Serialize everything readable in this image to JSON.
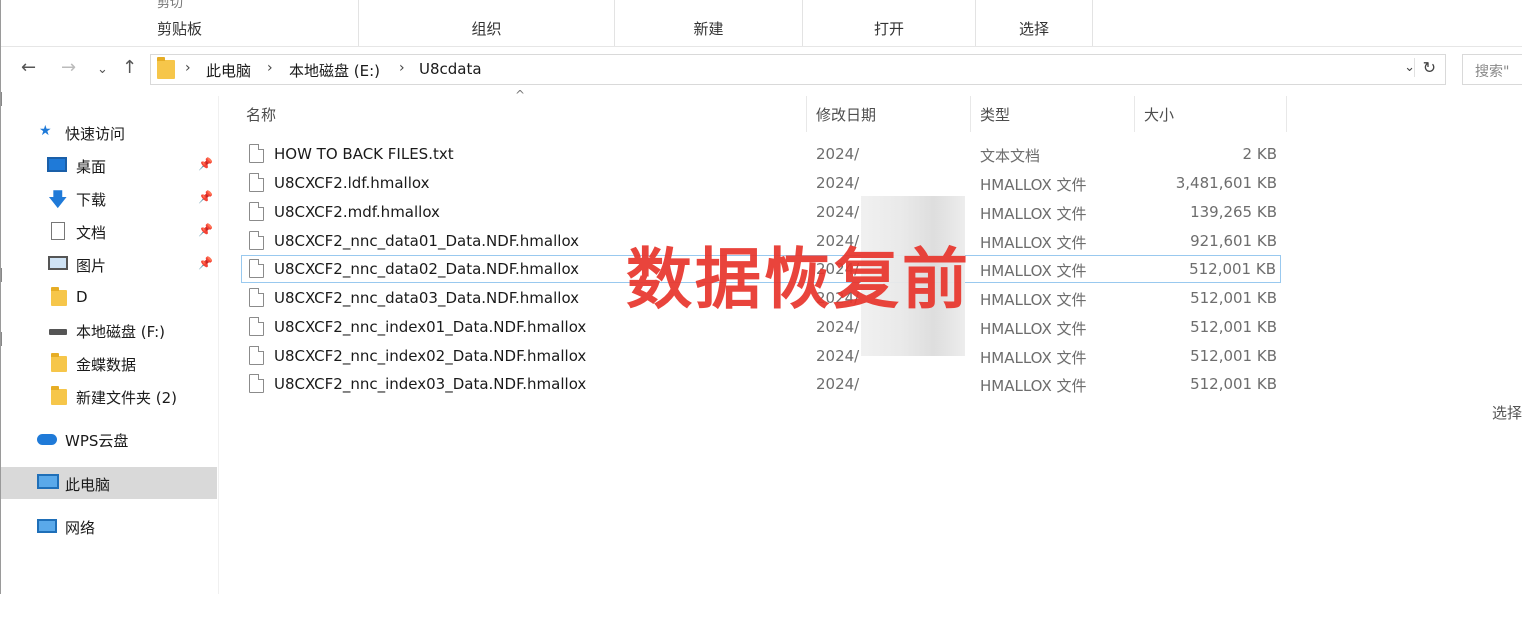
{
  "ribbon": {
    "stub_label": "剪切",
    "groups": [
      "剪贴板",
      "组织",
      "新建",
      "打开",
      "选择"
    ]
  },
  "nav": {
    "back": "←",
    "forward": "→",
    "recent": "⌄",
    "up": "↑"
  },
  "address": {
    "crumbs": [
      "此电脑",
      "本地磁盘 (E:)",
      "U8cdata"
    ],
    "separator": "›",
    "dropdown": "⌄",
    "refresh": "↻"
  },
  "search": {
    "placeholder": "搜索\""
  },
  "sidebar": {
    "items": [
      {
        "label": "快速访问"
      },
      {
        "label": "桌面"
      },
      {
        "label": "下载"
      },
      {
        "label": "文档"
      },
      {
        "label": "图片"
      },
      {
        "label": "D"
      },
      {
        "label": "本地磁盘 (F:)"
      },
      {
        "label": "金蝶数据"
      },
      {
        "label": "新建文件夹 (2)"
      },
      {
        "label": "WPS云盘"
      },
      {
        "label": "此电脑"
      },
      {
        "label": "网络"
      }
    ],
    "pin_glyph": "📌"
  },
  "columns": [
    "名称",
    "修改日期",
    "类型",
    "大小"
  ],
  "sort_caret": "^",
  "files": [
    {
      "name": "HOW TO BACK FILES.txt",
      "date": "2024/",
      "type": "文本文档",
      "size": "2 KB"
    },
    {
      "name": "U8CXCF2.ldf.hmallox",
      "date": "2024/",
      "type": "HMALLOX 文件",
      "size": "3,481,601 KB"
    },
    {
      "name": "U8CXCF2.mdf.hmallox",
      "date": "2024/",
      "type": "HMALLOX 文件",
      "size": "139,265 KB"
    },
    {
      "name": "U8CXCF2_nnc_data01_Data.NDF.hmallox",
      "date": "2024/",
      "type": "HMALLOX 文件",
      "size": "921,601 KB"
    },
    {
      "name": "U8CXCF2_nnc_data02_Data.NDF.hmallox",
      "date": "2024/",
      "type": "HMALLOX 文件",
      "size": "512,001 KB"
    },
    {
      "name": "U8CXCF2_nnc_data03_Data.NDF.hmallox",
      "date": "2024/",
      "type": "HMALLOX 文件",
      "size": "512,001 KB"
    },
    {
      "name": "U8CXCF2_nnc_index01_Data.NDF.hmallox",
      "date": "2024/",
      "type": "HMALLOX 文件",
      "size": "512,001 KB"
    },
    {
      "name": "U8CXCF2_nnc_index02_Data.NDF.hmallox",
      "date": "2024/",
      "type": "HMALLOX 文件",
      "size": "512,001 KB"
    },
    {
      "name": "U8CXCF2_nnc_index03_Data.NDF.hmallox",
      "date": "2024/",
      "type": "HMALLOX 文件",
      "size": "512,001 KB"
    }
  ],
  "overlay_text": "数据恢复前",
  "right_stub": "选择",
  "colors": {
    "overlay": "#e8352c",
    "selected_bg": "#d9d9d9",
    "focus_border": "#99c9ef",
    "folder": "#f6c64a",
    "accent_blue": "#1f7ad8"
  }
}
